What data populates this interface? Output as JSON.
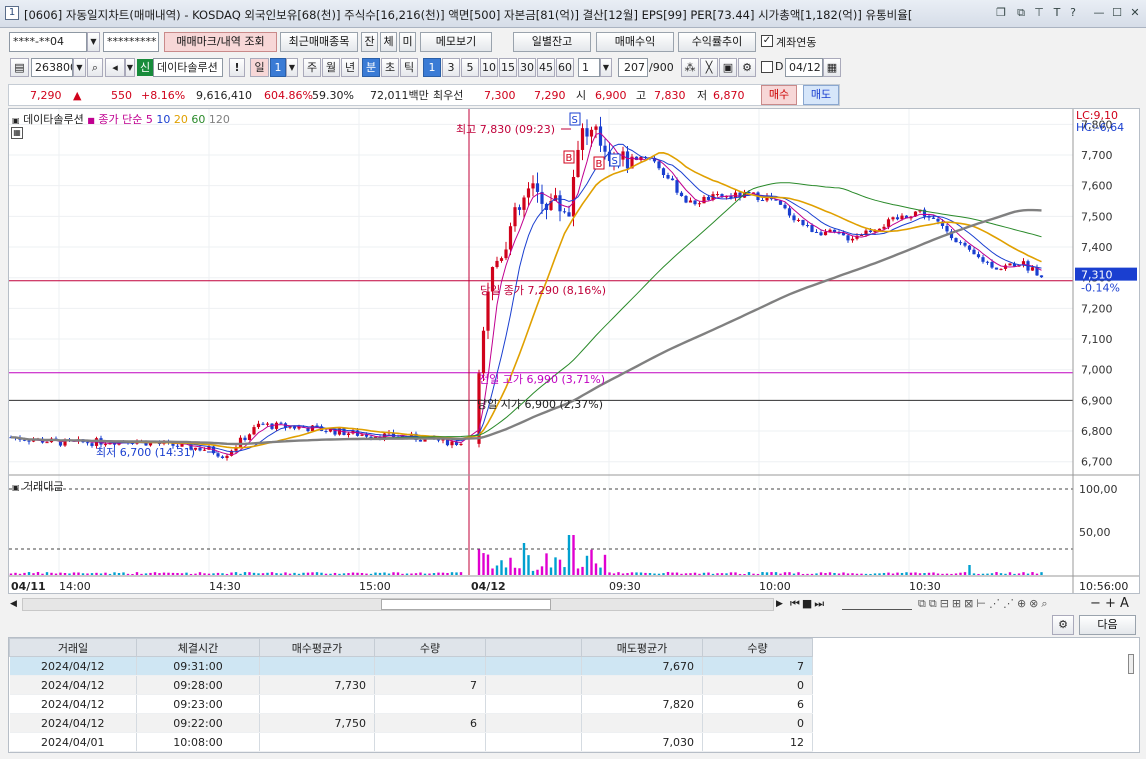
{
  "window": {
    "number": "1",
    "title": "[0606] 자동일지차트(매매내역) - KOSDAQ 외국인보유[68(천)] 주식수[16,216(천)] 액면[500] 자본금[81(억)] 결산[12월] EPS[99] PER[73.44] 시가총액[1,182(억)] 유통비율["
  },
  "toolbar1": {
    "account": "****-**04",
    "password": "*********",
    "buttons": [
      "매매마크/내역 조회",
      "최근매매종목",
      "잔",
      "체",
      "미",
      "메모보기",
      "일별잔고",
      "매매수익",
      "수익률추이"
    ],
    "checkbox_label": "계좌연동"
  },
  "toolbar2": {
    "code": "263800",
    "sin_badge": "신",
    "stock_name": "데이타솔루션",
    "period_buttons": [
      "일",
      "1",
      "주",
      "월",
      "년",
      "분",
      "초",
      "틱"
    ],
    "minute_buttons": [
      "1",
      "3",
      "5",
      "10",
      "15",
      "30",
      "45",
      "60"
    ],
    "unit_value": "1",
    "count": "207",
    "count_total": "/900",
    "d_label": "D",
    "date": "04/12"
  },
  "quote": {
    "price": "7,290",
    "arrow": "▲",
    "change": "550",
    "change_pct": "+8.16%",
    "volume": "9,616,410",
    "vol_ratio": "604.86%",
    "turnover": "59.30%",
    "amount": "72,011백만",
    "best_label": "최우선",
    "best_ask": "7,300",
    "best_bid": "7,290",
    "open_label": "시",
    "open": "6,900",
    "high_label": "고",
    "high": "7,830",
    "low_label": "저",
    "low": "6,870",
    "buy_label": "매수",
    "sell_label": "매도"
  },
  "chart": {
    "legend_name": "데이타솔루션",
    "ma_label": "종가 단순",
    "ma_periods": [
      "5",
      "10",
      "20",
      "60",
      "120"
    ],
    "lc": "LC:9,10",
    "hc": "HC:-6,64",
    "current_price": "7,310",
    "current_pct": "-0.14%",
    "high_note": "최고 7,830 (09:23)",
    "low_note": "최저 6,700 (14:31)",
    "today_close_note": "당일 종가 7,290 (8,16%)",
    "prev_high_note": "전일 고가 6,990 (3,71%)",
    "today_open_note": "당일 시가 6,900 (2,37%)",
    "volume_panel_label": "거래대금",
    "time_end": "10:56:00",
    "date_labels": [
      "04/11",
      "04/12"
    ],
    "time_labels": [
      "14:00",
      "14:30",
      "15:00",
      "09:30",
      "10:00",
      "10:30"
    ],
    "volume_axis": [
      "100,00",
      "50,00"
    ],
    "price_axis": [
      "7,800",
      "7,700",
      "7,600",
      "7,500",
      "7,400",
      "7,300",
      "7,200",
      "7,100",
      "7,000",
      "6,900",
      "6,800",
      "6,700"
    ],
    "trade_marks": [
      "S",
      "B",
      "B",
      "S"
    ],
    "colors": {
      "up": "#d0021b",
      "down": "#1a3fd0",
      "ma5": "#c00090",
      "ma20": "#e0a000",
      "ma60": "#2a8a2a",
      "ma120": "#808080"
    }
  },
  "table": {
    "next_button": "다음",
    "headers": [
      "거래일",
      "체결시간",
      "매수평균가",
      "수량",
      "",
      "매도평균가",
      "수량"
    ],
    "rows": [
      [
        "2024/04/12",
        "09:31:00",
        "",
        "",
        "",
        "7,670",
        "7"
      ],
      [
        "2024/04/12",
        "09:28:00",
        "7,730",
        "7",
        "",
        "",
        "0"
      ],
      [
        "2024/04/12",
        "09:23:00",
        "",
        "",
        "",
        "7,820",
        "6"
      ],
      [
        "2024/04/12",
        "09:22:00",
        "7,750",
        "6",
        "",
        "",
        "0"
      ],
      [
        "2024/04/01",
        "10:08:00",
        "",
        "",
        "",
        "7,030",
        "12"
      ]
    ]
  }
}
